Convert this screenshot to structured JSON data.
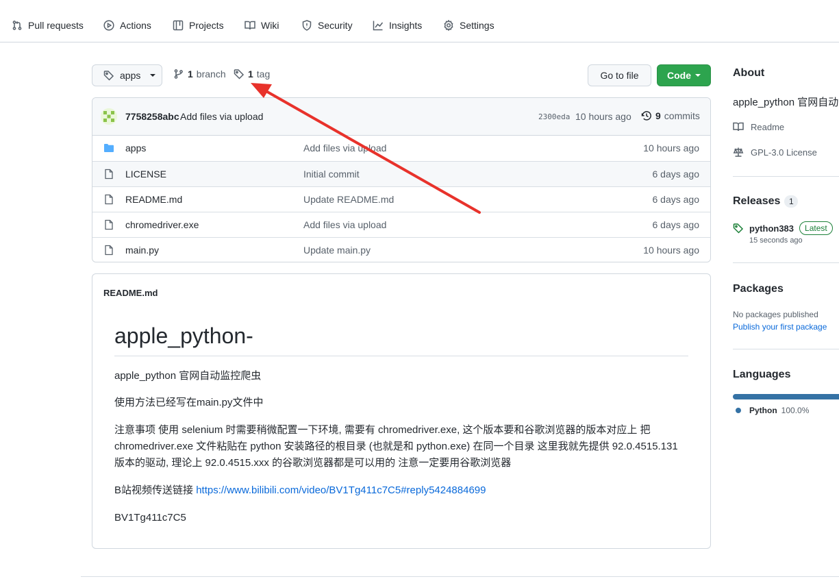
{
  "nav": {
    "items": [
      {
        "label": "Pull requests",
        "icon": "pull-request-icon"
      },
      {
        "label": "Actions",
        "icon": "play-icon"
      },
      {
        "label": "Projects",
        "icon": "table-icon"
      },
      {
        "label": "Wiki",
        "icon": "book-icon"
      },
      {
        "label": "Security",
        "icon": "shield-icon"
      },
      {
        "label": "Insights",
        "icon": "graph-icon"
      },
      {
        "label": "Settings",
        "icon": "gear-icon"
      }
    ]
  },
  "toolbar": {
    "ref_label": "apps",
    "branch_count": "1",
    "branch_label": "branch",
    "tag_count": "1",
    "tag_label": "tag",
    "go_to_file": "Go to file",
    "code": "Code"
  },
  "commit": {
    "author": "7758258abc",
    "message": "Add files via upload",
    "hash": "2300eda",
    "time": "10 hours ago",
    "count": "9",
    "count_label": "commits"
  },
  "files": [
    {
      "name": "apps",
      "type": "folder",
      "message": "Add files via upload",
      "age": "10 hours ago"
    },
    {
      "name": "LICENSE",
      "type": "file",
      "message": "Initial commit",
      "age": "6 days ago"
    },
    {
      "name": "README.md",
      "type": "file",
      "message": "Update README.md",
      "age": "6 days ago"
    },
    {
      "name": "chromedriver.exe",
      "type": "file",
      "message": "Add files via upload",
      "age": "6 days ago"
    },
    {
      "name": "main.py",
      "type": "file",
      "message": "Update main.py",
      "age": "10 hours ago"
    }
  ],
  "readme": {
    "file_label": "README.md",
    "title": "apple_python-",
    "p1": "apple_python 官网自动监控爬虫",
    "p2": "使用方法已经写在main.py文件中",
    "p3": "注意事项 使用 selenium 时需要稍微配置一下环境, 需要有 chromedriver.exe, 这个版本要和谷歌浏览器的版本对应上 把 chromedriver.exe 文件粘贴在 python 安装路径的根目录 (也就是和 python.exe) 在同一个目录 这里我就先提供 92.0.4515.131 版本的驱动, 理论上 92.0.4515.xxx 的谷歌浏览器都是可以用的 注意一定要用谷歌浏览器",
    "p4_prefix": "B站视频传送链接 ",
    "p4_link": "https://www.bilibili.com/video/BV1Tg411c7C5#reply5424884699",
    "p5": "BV1Tg411c7C5"
  },
  "sidebar": {
    "about_title": "About",
    "about_desc": "apple_python 官网自动",
    "readme_link": "Readme",
    "license_link": "GPL-3.0 License",
    "releases_title": "Releases",
    "releases_count": "1",
    "release_name": "python383",
    "release_badge": "Latest",
    "release_time": "15 seconds ago",
    "packages_title": "Packages",
    "packages_empty": "No packages published",
    "packages_link": "Publish your first package",
    "languages_title": "Languages",
    "language_name": "Python",
    "language_pct": "100.0%",
    "language_color": "#3572A5"
  },
  "colors": {
    "accent": "#2da44e",
    "link": "#0969da",
    "annotation_arrow": "#e8322b"
  }
}
